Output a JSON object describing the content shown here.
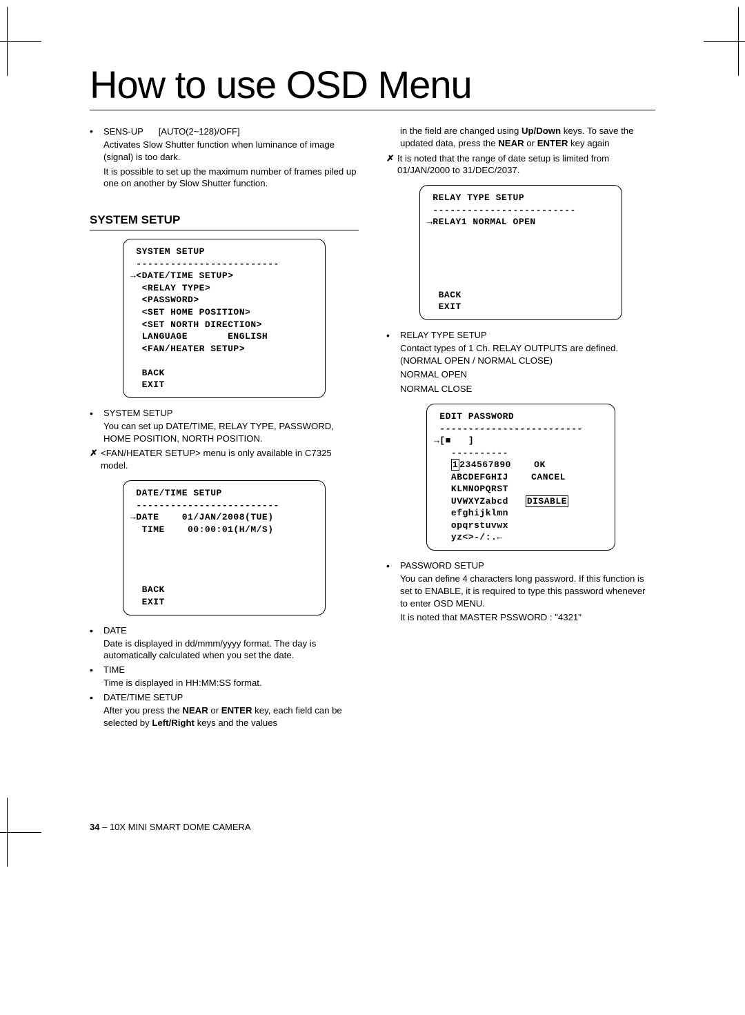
{
  "title": "How to use OSD Menu",
  "left": {
    "sensup": {
      "label": "SENS-UP",
      "option": "[AUTO(2~128)/OFF]",
      "line1": "Activates Slow Shutter function when luminance of image (signal) is too dark.",
      "line2": "It is possible to set up the maximum number of frames piled up one on another by Slow Shutter function."
    },
    "sectionTitle": "SYSTEM SETUP",
    "osd1": " SYSTEM SETUP\n -------------------------\n→<DATE/TIME SETUP>\n  <RELAY TYPE>\n  <PASSWORD>\n  <SET HOME POSITION>\n  <SET NORTH DIRECTION>\n  LANGUAGE       ENGLISH\n  <FAN/HEATER SETUP>\n\n  BACK\n  EXIT",
    "sysSetup": {
      "label": "SYSTEM SETUP",
      "desc": "You can set up DATE/TIME, RELAY TYPE, PASSWORD, HOME POSITION, NORTH POSITION."
    },
    "fanNote": "<FAN/HEATER SETUP> menu is only available in C7325 model.",
    "osd2": " DATE/TIME SETUP\n -------------------------\n→DATE    01/JAN/2008(TUE)\n  TIME    00:00:01(H/M/S)\n\n\n\n\n  BACK\n  EXIT",
    "date": {
      "label": "DATE",
      "desc": "Date is displayed in dd/mmm/yyyy format. The day is automatically calculated when you set the date."
    },
    "time": {
      "label": "TIME",
      "desc": "Time is displayed in HH:MM:SS format."
    },
    "dtsetup": {
      "label": "DATE/TIME SETUP",
      "desc_a": "After you press the ",
      "desc_b": " or ",
      "desc_c": " key, each field can be selected by ",
      "desc_d": " keys and the values",
      "near": "NEAR",
      "enter": "ENTER",
      "leftright": "Left/Right"
    }
  },
  "right": {
    "cont": {
      "a": "in the field are changed using ",
      "updown": "Up/Down",
      "b": " keys. To save the updated data, press the ",
      "near": "NEAR",
      "c": " or ",
      "enter": "ENTER",
      "d": " key again"
    },
    "rangeNote": "It is noted that the range of date setup is limited from 01/JAN/2000 to 31/DEC/2037.",
    "osd3": " RELAY TYPE SETUP\n -------------------------\n→RELAY1 NORMAL OPEN\n\n\n\n\n\n  BACK\n  EXIT",
    "relay": {
      "label": "RELAY TYPE SETUP",
      "desc": "Contact types of 1 Ch. RELAY OUTPUTS are defined. (NORMAL OPEN / NORMAL CLOSE)",
      "opt1": "NORMAL OPEN",
      "opt2": "NORMAL CLOSE"
    },
    "osd4": {
      "title": " EDIT PASSWORD",
      "divider": " -------------------------",
      "row_input_prefix": "→[",
      "row_input_mid": "   ]",
      "div2": "   ----------",
      "r1a": "   ",
      "r1b": "1",
      "r1c": "234567890",
      "r1ok": "    OK",
      "r2": "   ABCDEFGHIJ    CANCEL",
      "r3": "   KLMNOPQRST",
      "r4a": "   UVWXYZabcd   ",
      "r4dis": "DISABLE",
      "r5": "   efghijklmn",
      "r6": "   opqrstuvwx",
      "r7": "   yz<>-/:.←"
    },
    "pwd": {
      "label": "PASSWORD SETUP",
      "desc1": "You can define 4 characters long password. If this function is set to ENABLE, it is required to type this password whenever to enter OSD MENU.",
      "desc2": "It is noted that MASTER PSSWORD : \"4321\""
    }
  },
  "footer": {
    "page": "34",
    "sep": " – ",
    "text": "10X MINI SMART DOME CAMERA"
  }
}
